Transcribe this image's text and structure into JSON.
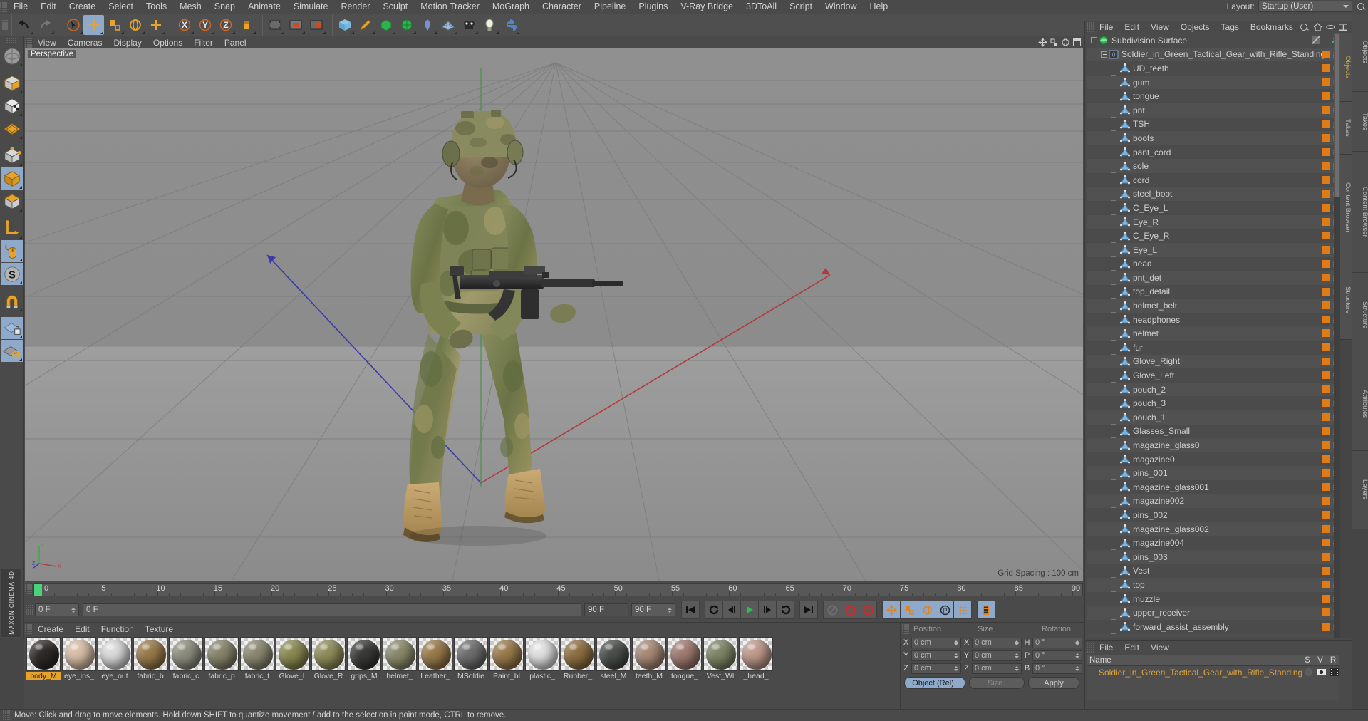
{
  "app": {
    "name": "MAXON CINEMA 4D"
  },
  "menubar": {
    "items": [
      "File",
      "Edit",
      "Create",
      "Select",
      "Tools",
      "Mesh",
      "Snap",
      "Animate",
      "Simulate",
      "Render",
      "Sculpt",
      "Motion Tracker",
      "MoGraph",
      "Character",
      "Pipeline",
      "Plugins",
      "V-Ray Bridge",
      "3DToAll",
      "Script",
      "Window",
      "Help"
    ],
    "layout_label": "Layout:",
    "layout_value": "Startup (User)",
    "search_icon": "search-icon"
  },
  "main_toolbar": {
    "groups": [
      {
        "buttons": [
          {
            "name": "undo-button",
            "icon": "undo-arrow-icon",
            "active": false
          },
          {
            "name": "redo-button",
            "icon": "redo-arrow-icon",
            "active": false
          }
        ]
      },
      {
        "buttons": [
          {
            "name": "live-selection-tool",
            "icon": "cursor-circle-icon",
            "active": false
          },
          {
            "name": "move-tool",
            "icon": "move-cross-icon",
            "active": true
          },
          {
            "name": "scale-tool",
            "icon": "scale-icon",
            "active": false
          },
          {
            "name": "rotate-tool",
            "icon": "rotate-icon",
            "active": false
          },
          {
            "name": "add-tool",
            "icon": "plus-cross-icon",
            "active": false
          }
        ]
      },
      {
        "buttons": [
          {
            "name": "x-axis-lock",
            "icon": "axis-x-icon",
            "active": false
          },
          {
            "name": "y-axis-lock",
            "icon": "axis-y-icon",
            "active": false
          },
          {
            "name": "z-axis-lock",
            "icon": "axis-z-icon",
            "active": false
          },
          {
            "name": "world-object-coord",
            "icon": "world-axis-icon",
            "active": false
          }
        ]
      },
      {
        "buttons": [
          {
            "name": "render-view-button",
            "icon": "render-view-icon",
            "active": false
          },
          {
            "name": "render-region-button",
            "icon": "render-region-icon",
            "active": false
          },
          {
            "name": "render-settings-button",
            "icon": "render-settings-icon",
            "active": false
          }
        ]
      },
      {
        "buttons": [
          {
            "name": "primitive-cube-button",
            "icon": "cube-icon",
            "active": false
          },
          {
            "name": "spline-pen-button",
            "icon": "pen-icon",
            "active": false
          },
          {
            "name": "generator-button",
            "icon": "generator-icon",
            "active": false
          },
          {
            "name": "deformer-button",
            "icon": "deformer-icon",
            "active": false
          },
          {
            "name": "environment-button",
            "icon": "sky-icon",
            "active": false
          },
          {
            "name": "scene-button",
            "icon": "floor-icon",
            "active": false
          },
          {
            "name": "camera-button",
            "icon": "camera-icon",
            "active": false
          },
          {
            "name": "light-button",
            "icon": "light-bulb-icon",
            "active": false
          },
          {
            "name": "python-button",
            "icon": "python-icon",
            "active": false
          }
        ]
      }
    ]
  },
  "left_toolbar": {
    "buttons": [
      {
        "name": "tool-texture-axis",
        "icon": "texture-sphere-icon",
        "active": false
      },
      {
        "name": "tool-model-mode",
        "icon": "model-cube-icon",
        "active": false
      },
      {
        "name": "tool-texture-mode",
        "icon": "texture-cube-icon",
        "active": false
      },
      {
        "name": "tool-workplane-mode",
        "icon": "workplane-grid-icon",
        "active": false
      },
      {
        "name": "tool-point-mode",
        "icon": "point-mode-icon",
        "active": false
      },
      {
        "name": "tool-edge-mode",
        "icon": "edge-mode-icon",
        "active": true
      },
      {
        "name": "tool-polygon-mode",
        "icon": "polygon-mode-icon",
        "active": false
      },
      {
        "name": "tool-axis-modify",
        "icon": "axis-modify-icon",
        "active": false
      },
      {
        "name": "tool-enable-snapping",
        "icon": "mouse-icon",
        "active": true
      },
      {
        "name": "tool-soft-selection",
        "icon": "soft-selection-icon",
        "active": true
      },
      {
        "name": "tool-magnet",
        "icon": "magnet-icon",
        "active": false
      },
      {
        "name": "tool-lock-workplane",
        "icon": "workplane-lock-icon",
        "active": true
      },
      {
        "name": "tool-planar-workplane",
        "icon": "workplane-rotate-icon",
        "active": true
      }
    ]
  },
  "viewport": {
    "menu": [
      "View",
      "Cameras",
      "Display",
      "Options",
      "Filter",
      "Panel"
    ],
    "label": "Perspective",
    "grid_spacing": "Grid Spacing : 100 cm",
    "axis_labels": {
      "x": "X",
      "y": "Y",
      "z": "Z"
    },
    "icons": [
      "viewport-move-icon",
      "viewport-scale-icon",
      "viewport-rotate-icon",
      "viewport-maximize-icon"
    ],
    "scene_description": "3D soldier in green tactical camouflage gear holding a rifle, standing on a grey perspective grid"
  },
  "timeline": {
    "start_frame": "0 F",
    "end_frame": "90 F",
    "current_frame": "0 F",
    "preview_start": "0 F",
    "preview_end": "90 F",
    "tick_labels": [
      "0",
      "5",
      "10",
      "15",
      "20",
      "25",
      "30",
      "35",
      "40",
      "45",
      "50",
      "55",
      "60",
      "65",
      "70",
      "75",
      "80",
      "85",
      "90"
    ],
    "tick_min": 0,
    "tick_max": 90,
    "transport_buttons": [
      {
        "name": "go-to-start-button",
        "icon": "skip-start-icon"
      },
      {
        "name": "play-backwards-button",
        "icon": "loop-back-icon"
      },
      {
        "name": "previous-frame-button",
        "icon": "step-back-icon"
      },
      {
        "name": "play-button",
        "icon": "play-icon"
      },
      {
        "name": "next-frame-button",
        "icon": "step-forward-icon"
      },
      {
        "name": "play-forwards-button",
        "icon": "loop-forward-icon"
      },
      {
        "name": "go-to-end-button",
        "icon": "skip-end-icon"
      },
      {
        "name": "record-active-objects-button",
        "icon": "record-disabled-icon"
      },
      {
        "name": "autokeying-button",
        "icon": "record-circle-icon"
      },
      {
        "name": "keyframe-selection-button",
        "icon": "question-circle-icon"
      },
      {
        "name": "position-key-button",
        "icon": "position-axis-icon"
      },
      {
        "name": "scale-key-button",
        "icon": "scale-key-icon"
      },
      {
        "name": "rotation-key-button",
        "icon": "rotation-key-icon"
      },
      {
        "name": "parameter-key-button",
        "icon": "parameter-p-icon"
      },
      {
        "name": "point-level-anim-button",
        "icon": "point-grid-icon"
      },
      {
        "name": "timeline-mode-button",
        "icon": "film-strip-icon"
      }
    ]
  },
  "material_manager": {
    "menu": [
      "Create",
      "Edit",
      "Function",
      "Texture"
    ],
    "materials": [
      {
        "name": "body_M",
        "color": "#2e2b28",
        "selected": true
      },
      {
        "name": "eye_ins_",
        "color": "#d9bfa8",
        "selected": false
      },
      {
        "name": "eye_out",
        "color": "#dcdcdc",
        "selected": false
      },
      {
        "name": "fabric_b",
        "color": "#9a7a4a",
        "selected": false
      },
      {
        "name": "fabric_c",
        "color": "#8f8f80",
        "selected": false
      },
      {
        "name": "fabric_p",
        "color": "#87856b",
        "selected": false
      },
      {
        "name": "fabric_t",
        "color": "#8b8972",
        "selected": false
      },
      {
        "name": "Glove_L",
        "color": "#8b8a52",
        "selected": false
      },
      {
        "name": "Glove_R",
        "color": "#8f8d59",
        "selected": false
      },
      {
        "name": "grips_M",
        "color": "#3a3a38",
        "selected": false
      },
      {
        "name": "helmet_",
        "color": "#8a8b6c",
        "selected": false
      },
      {
        "name": "Leather_",
        "color": "#9a7a4a",
        "selected": false
      },
      {
        "name": "MSoldie",
        "color": "#6d6d6d",
        "selected": false
      },
      {
        "name": "Paint_bl",
        "color": "#9a7a4a",
        "selected": false
      },
      {
        "name": "plastic_",
        "color": "#e2e2e2",
        "selected": false
      },
      {
        "name": "Rubber_",
        "color": "#8f7042",
        "selected": false
      },
      {
        "name": "steel_M",
        "color": "#4a4f4a",
        "selected": false
      },
      {
        "name": "teeth_M",
        "color": "#a98a76",
        "selected": false
      },
      {
        "name": "tongue_",
        "color": "#a07a70",
        "selected": false
      },
      {
        "name": "Vest_Wl",
        "color": "#7e8566",
        "selected": false
      },
      {
        "name": "_head_",
        "color": "#c09a8d",
        "selected": false
      }
    ]
  },
  "coordinate_manager": {
    "position": {
      "label": "Position",
      "x": "0 cm",
      "y": "0 cm",
      "z": "0 cm"
    },
    "size": {
      "label": "Size",
      "x": "0 cm",
      "y": "0 cm",
      "z": "0 cm"
    },
    "rotation": {
      "label": "Rotation",
      "h": "0 °",
      "p": "0 °",
      "b": "0 °"
    },
    "axis_labels_left": [
      "X",
      "Y",
      "Z"
    ],
    "axis_labels_mid": [
      "X",
      "Y",
      "Z"
    ],
    "axis_labels_right": [
      "H",
      "P",
      "B"
    ],
    "mode_dropdown": "Object (Rel)",
    "size_dropdown": "Size",
    "apply_button": "Apply"
  },
  "object_manager": {
    "menu": [
      "File",
      "Edit",
      "View",
      "Objects",
      "Tags",
      "Bookmarks"
    ],
    "header_icons": [
      "search-icon",
      "home-icon",
      "ellipse-icon",
      "expand-icon"
    ],
    "items": [
      {
        "label": "Subdivision Surface",
        "depth": 0,
        "icon": "subdivision-surface-icon",
        "expander": "minus",
        "tag": "none",
        "check": true
      },
      {
        "label": "Soldier_in_Green_Tactical_Gear_with_Rifle_Standing",
        "depth": 1,
        "icon": "null-object-icon",
        "expander": "minus",
        "tag": "orange",
        "check": false
      },
      {
        "label": "UD_teeth",
        "depth": 2,
        "icon": "polygon-object-icon",
        "expander": "none",
        "tag": "orange"
      },
      {
        "label": "gum",
        "depth": 2,
        "icon": "polygon-object-icon",
        "expander": "none",
        "tag": "orange"
      },
      {
        "label": "tongue",
        "depth": 2,
        "icon": "polygon-object-icon",
        "expander": "none",
        "tag": "orange"
      },
      {
        "label": "pnt",
        "depth": 2,
        "icon": "polygon-object-icon",
        "expander": "none",
        "tag": "orange"
      },
      {
        "label": "TSH",
        "depth": 2,
        "icon": "polygon-object-icon",
        "expander": "none",
        "tag": "orange"
      },
      {
        "label": "boots",
        "depth": 2,
        "icon": "polygon-object-icon",
        "expander": "none",
        "tag": "orange"
      },
      {
        "label": "pant_cord",
        "depth": 2,
        "icon": "polygon-object-icon",
        "expander": "none",
        "tag": "orange"
      },
      {
        "label": "sole",
        "depth": 2,
        "icon": "polygon-object-icon",
        "expander": "none",
        "tag": "orange"
      },
      {
        "label": "cord",
        "depth": 2,
        "icon": "polygon-object-icon",
        "expander": "none",
        "tag": "orange"
      },
      {
        "label": "steel_boot",
        "depth": 2,
        "icon": "polygon-object-icon",
        "expander": "none",
        "tag": "orange"
      },
      {
        "label": "C_Eye_L",
        "depth": 2,
        "icon": "polygon-object-icon",
        "expander": "none",
        "tag": "orange"
      },
      {
        "label": "Eye_R",
        "depth": 2,
        "icon": "polygon-object-icon",
        "expander": "none",
        "tag": "orange"
      },
      {
        "label": "C_Eye_R",
        "depth": 2,
        "icon": "polygon-object-icon",
        "expander": "none",
        "tag": "orange"
      },
      {
        "label": "Eye_L",
        "depth": 2,
        "icon": "polygon-object-icon",
        "expander": "none",
        "tag": "orange"
      },
      {
        "label": "head",
        "depth": 2,
        "icon": "polygon-object-icon",
        "expander": "none",
        "tag": "orange"
      },
      {
        "label": "pnt_det",
        "depth": 2,
        "icon": "polygon-object-icon",
        "expander": "none",
        "tag": "orange"
      },
      {
        "label": "top_detail",
        "depth": 2,
        "icon": "polygon-object-icon",
        "expander": "none",
        "tag": "orange"
      },
      {
        "label": "helmet_belt",
        "depth": 2,
        "icon": "polygon-object-icon",
        "expander": "none",
        "tag": "orange"
      },
      {
        "label": "headphones",
        "depth": 2,
        "icon": "polygon-object-icon",
        "expander": "none",
        "tag": "orange"
      },
      {
        "label": "helmet",
        "depth": 2,
        "icon": "polygon-object-icon",
        "expander": "none",
        "tag": "orange"
      },
      {
        "label": "fur",
        "depth": 2,
        "icon": "polygon-object-icon",
        "expander": "none",
        "tag": "orange"
      },
      {
        "label": "Glove_Right",
        "depth": 2,
        "icon": "polygon-object-icon",
        "expander": "none",
        "tag": "orange"
      },
      {
        "label": "Glove_Left",
        "depth": 2,
        "icon": "polygon-object-icon",
        "expander": "none",
        "tag": "orange"
      },
      {
        "label": "pouch_2",
        "depth": 2,
        "icon": "polygon-object-icon",
        "expander": "none",
        "tag": "orange"
      },
      {
        "label": "pouch_3",
        "depth": 2,
        "icon": "polygon-object-icon",
        "expander": "none",
        "tag": "orange"
      },
      {
        "label": "pouch_1",
        "depth": 2,
        "icon": "polygon-object-icon",
        "expander": "none",
        "tag": "orange"
      },
      {
        "label": "Glasses_Small",
        "depth": 2,
        "icon": "polygon-object-icon",
        "expander": "none",
        "tag": "orange"
      },
      {
        "label": "magazine_glass0",
        "depth": 2,
        "icon": "polygon-object-icon",
        "expander": "none",
        "tag": "orange"
      },
      {
        "label": "magazine0",
        "depth": 2,
        "icon": "polygon-object-icon",
        "expander": "none",
        "tag": "orange"
      },
      {
        "label": "pins_001",
        "depth": 2,
        "icon": "polygon-object-icon",
        "expander": "none",
        "tag": "orange"
      },
      {
        "label": "magazine_glass001",
        "depth": 2,
        "icon": "polygon-object-icon",
        "expander": "none",
        "tag": "orange"
      },
      {
        "label": "magazine002",
        "depth": 2,
        "icon": "polygon-object-icon",
        "expander": "none",
        "tag": "orange"
      },
      {
        "label": "pins_002",
        "depth": 2,
        "icon": "polygon-object-icon",
        "expander": "none",
        "tag": "orange"
      },
      {
        "label": "magazine_glass002",
        "depth": 2,
        "icon": "polygon-object-icon",
        "expander": "none",
        "tag": "orange"
      },
      {
        "label": "magazine004",
        "depth": 2,
        "icon": "polygon-object-icon",
        "expander": "none",
        "tag": "orange"
      },
      {
        "label": "pins_003",
        "depth": 2,
        "icon": "polygon-object-icon",
        "expander": "none",
        "tag": "orange"
      },
      {
        "label": "Vest",
        "depth": 2,
        "icon": "polygon-object-icon",
        "expander": "none",
        "tag": "orange"
      },
      {
        "label": "top",
        "depth": 2,
        "icon": "polygon-object-icon",
        "expander": "none",
        "tag": "orange"
      },
      {
        "label": "muzzle",
        "depth": 2,
        "icon": "polygon-object-icon",
        "expander": "none",
        "tag": "orange"
      },
      {
        "label": "upper_receiver",
        "depth": 2,
        "icon": "polygon-object-icon",
        "expander": "none",
        "tag": "orange"
      },
      {
        "label": "forward_assist_assembly",
        "depth": 2,
        "icon": "polygon-object-icon",
        "expander": "none",
        "tag": "orange"
      }
    ],
    "side_tabs": [
      "Objects",
      "Takes",
      "Content Browser",
      "Structure"
    ]
  },
  "layer_manager": {
    "menu": [
      "File",
      "Edit",
      "View"
    ],
    "columns": [
      "Name",
      "S",
      "V",
      "R"
    ],
    "rows": [
      {
        "name": "Soldier_in_Green_Tactical_Gear_with_Rifle_Standing",
        "color": "#e07b1a"
      }
    ],
    "side_tabs": [
      "Attributes",
      "Layers"
    ]
  },
  "status_bar": {
    "message": "Move: Click and drag to move elements. Hold down SHIFT to quantize movement / add to the selection in point mode, CTRL to remove."
  }
}
